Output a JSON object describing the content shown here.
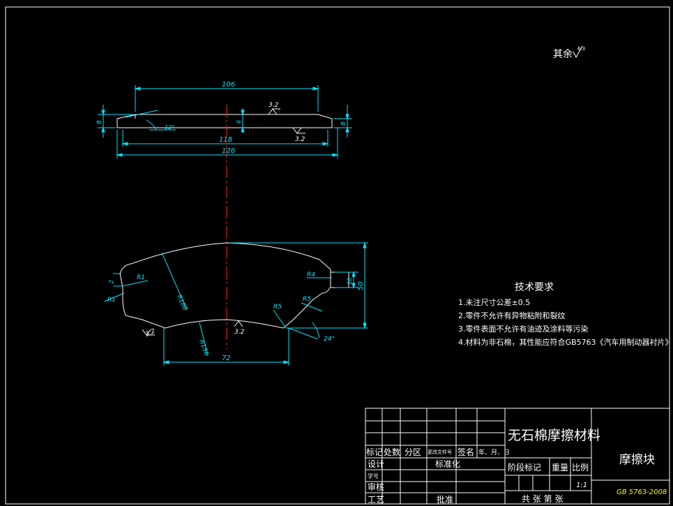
{
  "drawing": {
    "surface_finish_note": "其余",
    "surface_finish_value": "6.3",
    "colors": {
      "background": "#000000",
      "outline": "#ffffff",
      "dimension": "#00e5ff",
      "centerline": "#ff2020",
      "gb_code": "#ffff00"
    },
    "side_view": {
      "dim_106": "106",
      "dim_118": "118",
      "dim_126": "126",
      "dim_8": "8",
      "dim_6": "6",
      "angle_12": "12°",
      "roughness_top": "3.2",
      "roughness_bottom": "3.2"
    },
    "front_view": {
      "r1_upper": "R1",
      "r1_lower": "R1",
      "r186": "R186",
      "r156": "R156",
      "r4": "R4",
      "r5_left": "R5",
      "r5_right": "R5",
      "dim_10": "10",
      "dim_50": "50",
      "dim_72": "72",
      "dim_2": "2",
      "angle_24": "24°",
      "roughness_left": "3.2",
      "roughness_center": "3.2"
    }
  },
  "tech_requirements": {
    "title": "技术要求",
    "items": [
      "1.未注尺寸公差±0.5",
      "2.零件不允许有异物粘附和裂纹",
      "3.零件表面不允许有油迹及涂料等污染",
      "4.材料为非石棉，其性能应符合GB5763《汽车用制动器衬片》"
    ]
  },
  "title_block": {
    "material": "无石棉摩擦材料",
    "part_name": "摩擦块",
    "standard": "GB 5763-2008",
    "header": {
      "mark": "标记",
      "count": "处数",
      "zone": "分区",
      "doc": "更改文件号",
      "sign": "签名",
      "date": "年、月、日"
    },
    "design": "设计",
    "standardization": "标准化",
    "student_no": "学号",
    "review": "审核",
    "process": "工艺",
    "approve": "批准",
    "stage_mark": "阶段标记",
    "weight": "重量",
    "scale": "比例",
    "scale_value": "1:1",
    "sheets": "共 张  第 张"
  }
}
